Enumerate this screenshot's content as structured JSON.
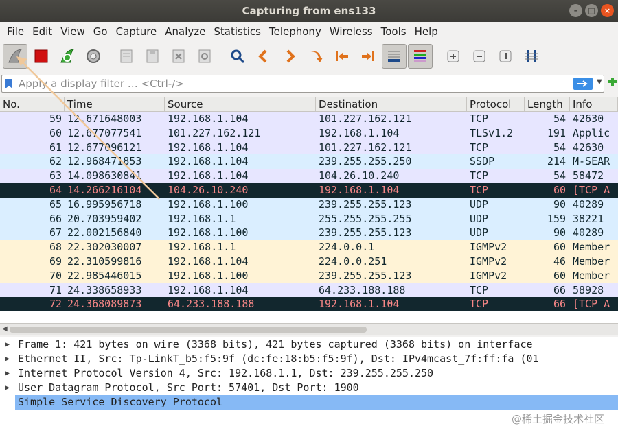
{
  "window": {
    "title": "Capturing from ens133",
    "controls": [
      "–",
      "□",
      "×"
    ]
  },
  "menu": {
    "items": [
      {
        "first": "F",
        "rest": "ile"
      },
      {
        "first": "E",
        "rest": "dit"
      },
      {
        "first": "V",
        "rest": "iew"
      },
      {
        "first": "G",
        "rest": "o"
      },
      {
        "first": "C",
        "rest": "apture"
      },
      {
        "first": "A",
        "rest": "nalyze"
      },
      {
        "first": "S",
        "rest": "tatistics"
      },
      {
        "first": "",
        "rest": "Telephon",
        "u": "y"
      },
      {
        "first": "W",
        "rest": "ireless"
      },
      {
        "first": "T",
        "rest": "ools"
      },
      {
        "first": "H",
        "rest": "elp"
      }
    ]
  },
  "toolbar": {
    "icons": [
      "shark-fin-start-icon",
      "stop-capture-icon",
      "restart-capture-icon",
      "capture-options-icon",
      "open-file-icon",
      "save-file-icon",
      "close-file-icon",
      "reload-file-icon",
      "find-packet-icon",
      "go-back-icon",
      "go-forward-icon",
      "go-to-packet-icon",
      "first-packet-icon",
      "last-packet-icon",
      "autoscroll-icon",
      "colorize-icon",
      "zoom-in-icon",
      "zoom-out-icon",
      "normal-size-icon",
      "resize-columns-icon"
    ]
  },
  "filter": {
    "placeholder": "Apply a display filter … <Ctrl-/>"
  },
  "packet_list": {
    "columns": [
      "No.",
      "Time",
      "Source",
      "Destination",
      "Protocol",
      "Length",
      "Info"
    ],
    "rows": [
      {
        "no": "59",
        "time": "12.671648003",
        "src": "192.168.1.104",
        "dst": "101.227.162.121",
        "proto": "TCP",
        "len": "54",
        "info": "42630",
        "bg": "#e7e6ff",
        "fg": "#12272e"
      },
      {
        "no": "60",
        "time": "12.677077541",
        "src": "101.227.162.121",
        "dst": "192.168.1.104",
        "proto": "TLSv1.2",
        "len": "191",
        "info": "Applic",
        "bg": "#e7e6ff",
        "fg": "#12272e"
      },
      {
        "no": "61",
        "time": "12.677096121",
        "src": "192.168.1.104",
        "dst": "101.227.162.121",
        "proto": "TCP",
        "len": "54",
        "info": "42630",
        "bg": "#e7e6ff",
        "fg": "#12272e"
      },
      {
        "no": "62",
        "time": "12.968471853",
        "src": "192.168.1.104",
        "dst": "239.255.255.250",
        "proto": "SSDP",
        "len": "214",
        "info": "M-SEAR",
        "bg": "#daeeff",
        "fg": "#12272e"
      },
      {
        "no": "63",
        "time": "14.098630841",
        "src": "192.168.1.104",
        "dst": "104.26.10.240",
        "proto": "TCP",
        "len": "54",
        "info": "58472",
        "bg": "#e7e6ff",
        "fg": "#12272e"
      },
      {
        "no": "64",
        "time": "14.266216104",
        "src": "104.26.10.240",
        "dst": "192.168.1.104",
        "proto": "TCP",
        "len": "60",
        "info": "[TCP A",
        "bg": "#12272e",
        "fg": "#f78787"
      },
      {
        "no": "65",
        "time": "16.995956718",
        "src": "192.168.1.100",
        "dst": "239.255.255.123",
        "proto": "UDP",
        "len": "90",
        "info": "40289",
        "bg": "#daeeff",
        "fg": "#12272e"
      },
      {
        "no": "66",
        "time": "20.703959402",
        "src": "192.168.1.1",
        "dst": "255.255.255.255",
        "proto": "UDP",
        "len": "159",
        "info": "38221",
        "bg": "#daeeff",
        "fg": "#12272e"
      },
      {
        "no": "67",
        "time": "22.002156840",
        "src": "192.168.1.100",
        "dst": "239.255.255.123",
        "proto": "UDP",
        "len": "90",
        "info": "40289",
        "bg": "#daeeff",
        "fg": "#12272e"
      },
      {
        "no": "68",
        "time": "22.302030007",
        "src": "192.168.1.1",
        "dst": "224.0.0.1",
        "proto": "IGMPv2",
        "len": "60",
        "info": "Member",
        "bg": "#fff3d6",
        "fg": "#12272e"
      },
      {
        "no": "69",
        "time": "22.310599816",
        "src": "192.168.1.104",
        "dst": "224.0.0.251",
        "proto": "IGMPv2",
        "len": "46",
        "info": "Member",
        "bg": "#fff3d6",
        "fg": "#12272e"
      },
      {
        "no": "70",
        "time": "22.985446015",
        "src": "192.168.1.100",
        "dst": "239.255.255.123",
        "proto": "IGMPv2",
        "len": "60",
        "info": "Member",
        "bg": "#fff3d6",
        "fg": "#12272e"
      },
      {
        "no": "71",
        "time": "24.338658933",
        "src": "192.168.1.104",
        "dst": "64.233.188.188",
        "proto": "TCP",
        "len": "66",
        "info": "58928",
        "bg": "#e7e6ff",
        "fg": "#12272e"
      },
      {
        "no": "72",
        "time": "24.368089873",
        "src": "64.233.188.188",
        "dst": "192.168.1.104",
        "proto": "TCP",
        "len": "66",
        "info": "[TCP A",
        "bg": "#12272e",
        "fg": "#f78787"
      }
    ]
  },
  "details": {
    "rows": [
      {
        "text": "Frame 1: 421 bytes on wire (3368 bits), 421 bytes captured (3368 bits) on interface",
        "selected": false
      },
      {
        "text": "Ethernet II, Src: Tp-LinkT_b5:f5:9f (dc:fe:18:b5:f5:9f), Dst: IPv4mcast_7f:ff:fa (01",
        "selected": false
      },
      {
        "text": "Internet Protocol Version 4, Src: 192.168.1.1, Dst: 239.255.255.250",
        "selected": false
      },
      {
        "text": "User Datagram Protocol, Src Port: 57401, Dst Port: 1900",
        "selected": false
      },
      {
        "text": "Simple Service Discovery Protocol",
        "selected": true
      }
    ]
  },
  "watermark": "@稀土掘金技术社区",
  "colors": {
    "titlebar": "#3c3b37",
    "close": "#e95420",
    "selected_detail": "#86b9f5",
    "annotation_arrow": "#f0c89a"
  }
}
